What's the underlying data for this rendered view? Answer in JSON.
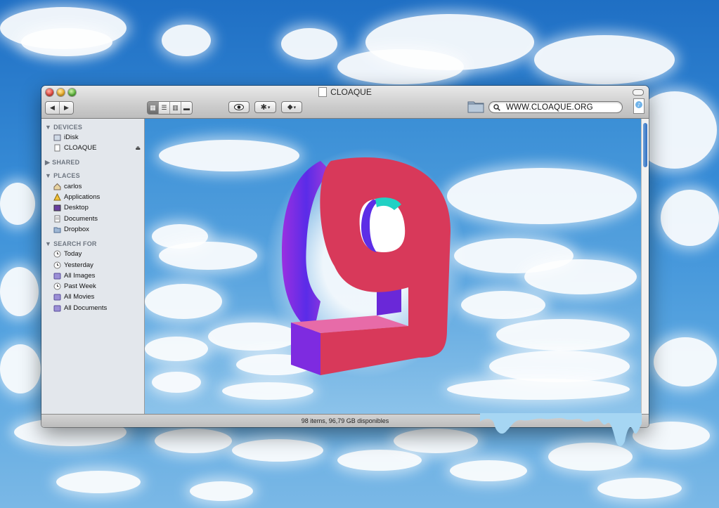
{
  "window": {
    "title": "CLOAQUE",
    "status": "98 items, 96,79 GB disponibles"
  },
  "toolbar": {
    "search_value": "WWW.CLOAQUE.ORG",
    "view_icons": [
      "icon-view-icon",
      "list-view-icon",
      "column-view-icon",
      "coverflow-view-icon"
    ]
  },
  "sidebar": {
    "sections": [
      {
        "title": "DEVICES",
        "items": [
          {
            "label": "iDisk",
            "icon": "idisk-icon"
          },
          {
            "label": "CLOAQUE",
            "icon": "drive-icon"
          }
        ]
      },
      {
        "title": "SHARED",
        "items": []
      },
      {
        "title": "PLACES",
        "items": [
          {
            "label": "carlos",
            "icon": "home-icon"
          },
          {
            "label": "Applications",
            "icon": "applications-icon"
          },
          {
            "label": "Desktop",
            "icon": "desktop-icon"
          },
          {
            "label": "Documents",
            "icon": "documents-icon"
          },
          {
            "label": "Dropbox",
            "icon": "folder-icon"
          }
        ]
      },
      {
        "title": "SEARCH FOR",
        "items": [
          {
            "label": "Today",
            "icon": "clock-icon"
          },
          {
            "label": "Yesterday",
            "icon": "clock-icon"
          },
          {
            "label": "All Images",
            "icon": "smart-folder-icon"
          },
          {
            "label": "Past Week",
            "icon": "clock-icon"
          },
          {
            "label": "All Movies",
            "icon": "smart-folder-icon"
          },
          {
            "label": "All Documents",
            "icon": "smart-folder-icon"
          }
        ]
      }
    ]
  },
  "colors": {
    "sky": "#3a8fd8",
    "logo_face": "#d8395a",
    "logo_side": "#7b2de0"
  }
}
